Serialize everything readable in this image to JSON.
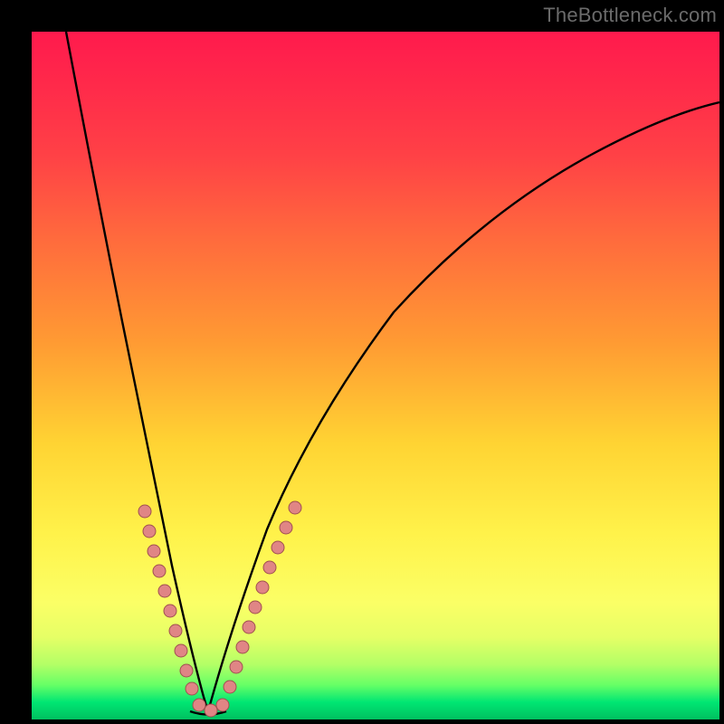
{
  "watermark": "TheBottleneck.com",
  "colors": {
    "frame": "#000000",
    "gradient_stops": [
      {
        "pos": 0.0,
        "hex": "#ff1a4d"
      },
      {
        "pos": 0.08,
        "hex": "#ff2a4a"
      },
      {
        "pos": 0.18,
        "hex": "#ff4146"
      },
      {
        "pos": 0.3,
        "hex": "#ff6a3d"
      },
      {
        "pos": 0.45,
        "hex": "#ff9a33"
      },
      {
        "pos": 0.6,
        "hex": "#ffd433"
      },
      {
        "pos": 0.73,
        "hex": "#fff24a"
      },
      {
        "pos": 0.83,
        "hex": "#fbff66"
      },
      {
        "pos": 0.88,
        "hex": "#e6ff66"
      },
      {
        "pos": 0.92,
        "hex": "#b3ff66"
      },
      {
        "pos": 0.95,
        "hex": "#66ff66"
      },
      {
        "pos": 0.975,
        "hex": "#00e673"
      },
      {
        "pos": 1.0,
        "hex": "#00c060"
      }
    ],
    "curve_stroke": "#000000",
    "marker_fill": "#e08585",
    "marker_stroke": "#a05050"
  },
  "chart_data": {
    "type": "line",
    "title": "",
    "xlabel": "",
    "ylabel": "",
    "xlim": [
      0,
      100
    ],
    "ylim": [
      0,
      100
    ],
    "note": "V-shaped bottleneck curve. Minimum ≈ x=25 at y≈0 (optimal/green). Axes numeric scale estimated from gridless plot.",
    "series": [
      {
        "name": "bottleneck_curve_left",
        "x": [
          5,
          8,
          11,
          14,
          17,
          20,
          22,
          23.5,
          25
        ],
        "values": [
          100,
          82,
          64,
          48,
          34,
          22,
          12,
          5,
          0
        ]
      },
      {
        "name": "bottleneck_curve_right",
        "x": [
          25,
          27,
          30,
          35,
          42,
          52,
          65,
          80,
          100
        ],
        "values": [
          0,
          6,
          15,
          30,
          46,
          62,
          75,
          84,
          90
        ]
      }
    ],
    "markers": {
      "name": "sample_points",
      "note": "pink dots on both branches in the yellow band (~y 8–30)",
      "points": [
        {
          "x": 15.5,
          "y": 30
        },
        {
          "x": 16.2,
          "y": 27
        },
        {
          "x": 17.0,
          "y": 24
        },
        {
          "x": 17.8,
          "y": 21
        },
        {
          "x": 18.7,
          "y": 18
        },
        {
          "x": 19.6,
          "y": 15
        },
        {
          "x": 20.6,
          "y": 12
        },
        {
          "x": 21.6,
          "y": 9
        },
        {
          "x": 22.6,
          "y": 6
        },
        {
          "x": 23.6,
          "y": 3
        },
        {
          "x": 24.6,
          "y": 1
        },
        {
          "x": 25.6,
          "y": 1
        },
        {
          "x": 26.6,
          "y": 1
        },
        {
          "x": 27.6,
          "y": 3
        },
        {
          "x": 28.5,
          "y": 6
        },
        {
          "x": 29.4,
          "y": 9
        },
        {
          "x": 30.3,
          "y": 12
        },
        {
          "x": 31.2,
          "y": 15
        },
        {
          "x": 32.2,
          "y": 18
        },
        {
          "x": 33.3,
          "y": 21
        },
        {
          "x": 34.4,
          "y": 24
        },
        {
          "x": 35.6,
          "y": 27
        },
        {
          "x": 36.8,
          "y": 30
        }
      ]
    }
  }
}
